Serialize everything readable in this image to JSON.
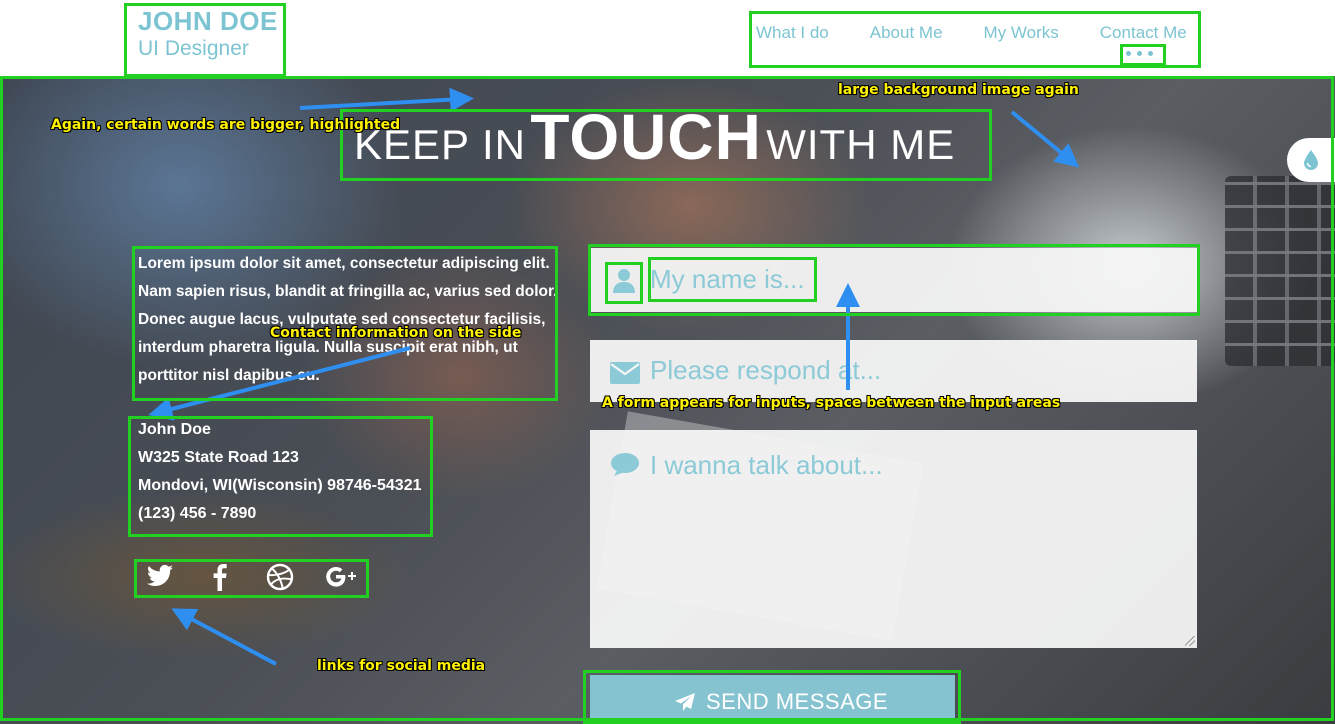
{
  "header": {
    "brand_name": "JOHN DOE",
    "brand_role": "UI Designer",
    "nav": [
      "What I do",
      "About Me",
      "My Works",
      "Contact Me"
    ]
  },
  "hero": {
    "title_part1": "KEEP IN",
    "title_highlight": "TOUCH",
    "title_part2": "WITH ME"
  },
  "contact": {
    "intro": "Lorem ipsum dolor sit amet, consectetur adipiscing elit. Nam sapien risus, blandit at fringilla ac, varius sed dolor. Donec augue lacus, vulputate sed consectetur facilisis, interdum pharetra ligula. Nulla suscipit erat nibh, ut porttitor nisl dapibus eu.",
    "name": "John Doe",
    "street": "W325 State Road 123",
    "city": "Mondovi, WI(Wisconsin) 98746-54321",
    "phone": "(123) 456 - 7890",
    "social_icons": [
      "twitter-icon",
      "facebook-icon",
      "dribbble-icon",
      "google-plus-icon"
    ]
  },
  "form": {
    "name_placeholder": "My name is...",
    "email_placeholder": "Please respond at...",
    "message_placeholder": "I wanna talk about...",
    "send_label": "SEND MESSAGE"
  },
  "annotations": {
    "highlight_note": "Again, certain words are bigger, highlighted",
    "background_note": "large background image again",
    "contact_note": "Contact information on the side",
    "form_note": "A form appears for inputs, space between the input areas",
    "social_note": "links for social media"
  },
  "colors": {
    "accent": "#7cc4d2",
    "button": "#86c3d1",
    "annotation_box": "#22d022",
    "annotation_text": "#fff200",
    "annotation_arrow": "#2f8ff0"
  }
}
